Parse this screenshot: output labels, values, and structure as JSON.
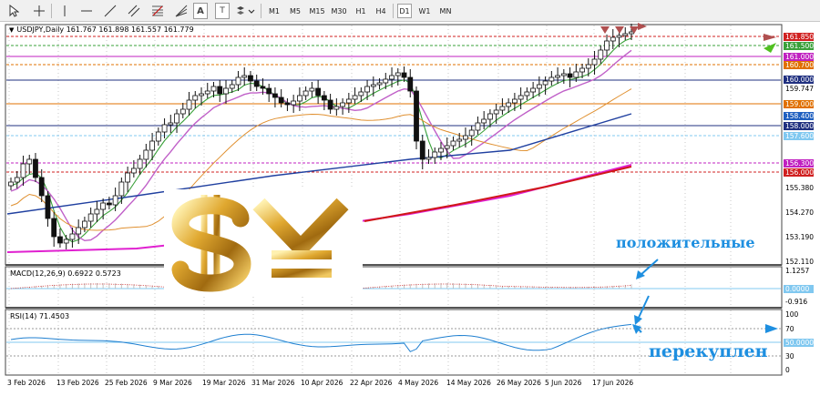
{
  "toolbar": {
    "timeframes": [
      "M1",
      "M5",
      "M15",
      "M30",
      "H1",
      "H4",
      "D1",
      "W1",
      "MN"
    ]
  },
  "chart": {
    "info": "USDJPY,Daily  161.767 161.898 161.557 161.779",
    "price_labels": [
      "161.850",
      "161.500",
      "161.000",
      "160.700",
      "160.000",
      "159.747",
      "159.000",
      "158.400",
      "158.000",
      "157.600",
      "156.300",
      "156.000",
      "155.380",
      "154.270",
      "153.190",
      "152.110"
    ],
    "dates": [
      "3 Feb 2026",
      "13 Feb 2026",
      "25 Feb 2026",
      "9 Mar 2026",
      "19 Mar 2026",
      "31 Mar 2026",
      "10 Apr 2026",
      "22 Apr 2026",
      "4 May 2026",
      "14 May 2026",
      "26 May 2026",
      "5 Jun 2026",
      "17 Jun 2026"
    ]
  },
  "macd": {
    "label": "MACD(12,26,9) 0.6922 0.5723",
    "scale": [
      "1.1257",
      "0.0000",
      "-0.916"
    ]
  },
  "rsi": {
    "label": "RSI(14) 71.4503",
    "scale": [
      "100",
      "70",
      "50.0000",
      "30",
      "0"
    ]
  },
  "annotations": {
    "positive": "положительные",
    "overbought": "перекуплен"
  },
  "colors": {
    "label_red": "#d02020",
    "label_green": "#3aa03a",
    "label_magenta": "#c020c0",
    "label_orange": "#e07000",
    "label_navy": "#203080",
    "label_blue": "#2060c0",
    "label_lightblue": "#80c8f0",
    "annotation": "#1e8fe0"
  }
}
